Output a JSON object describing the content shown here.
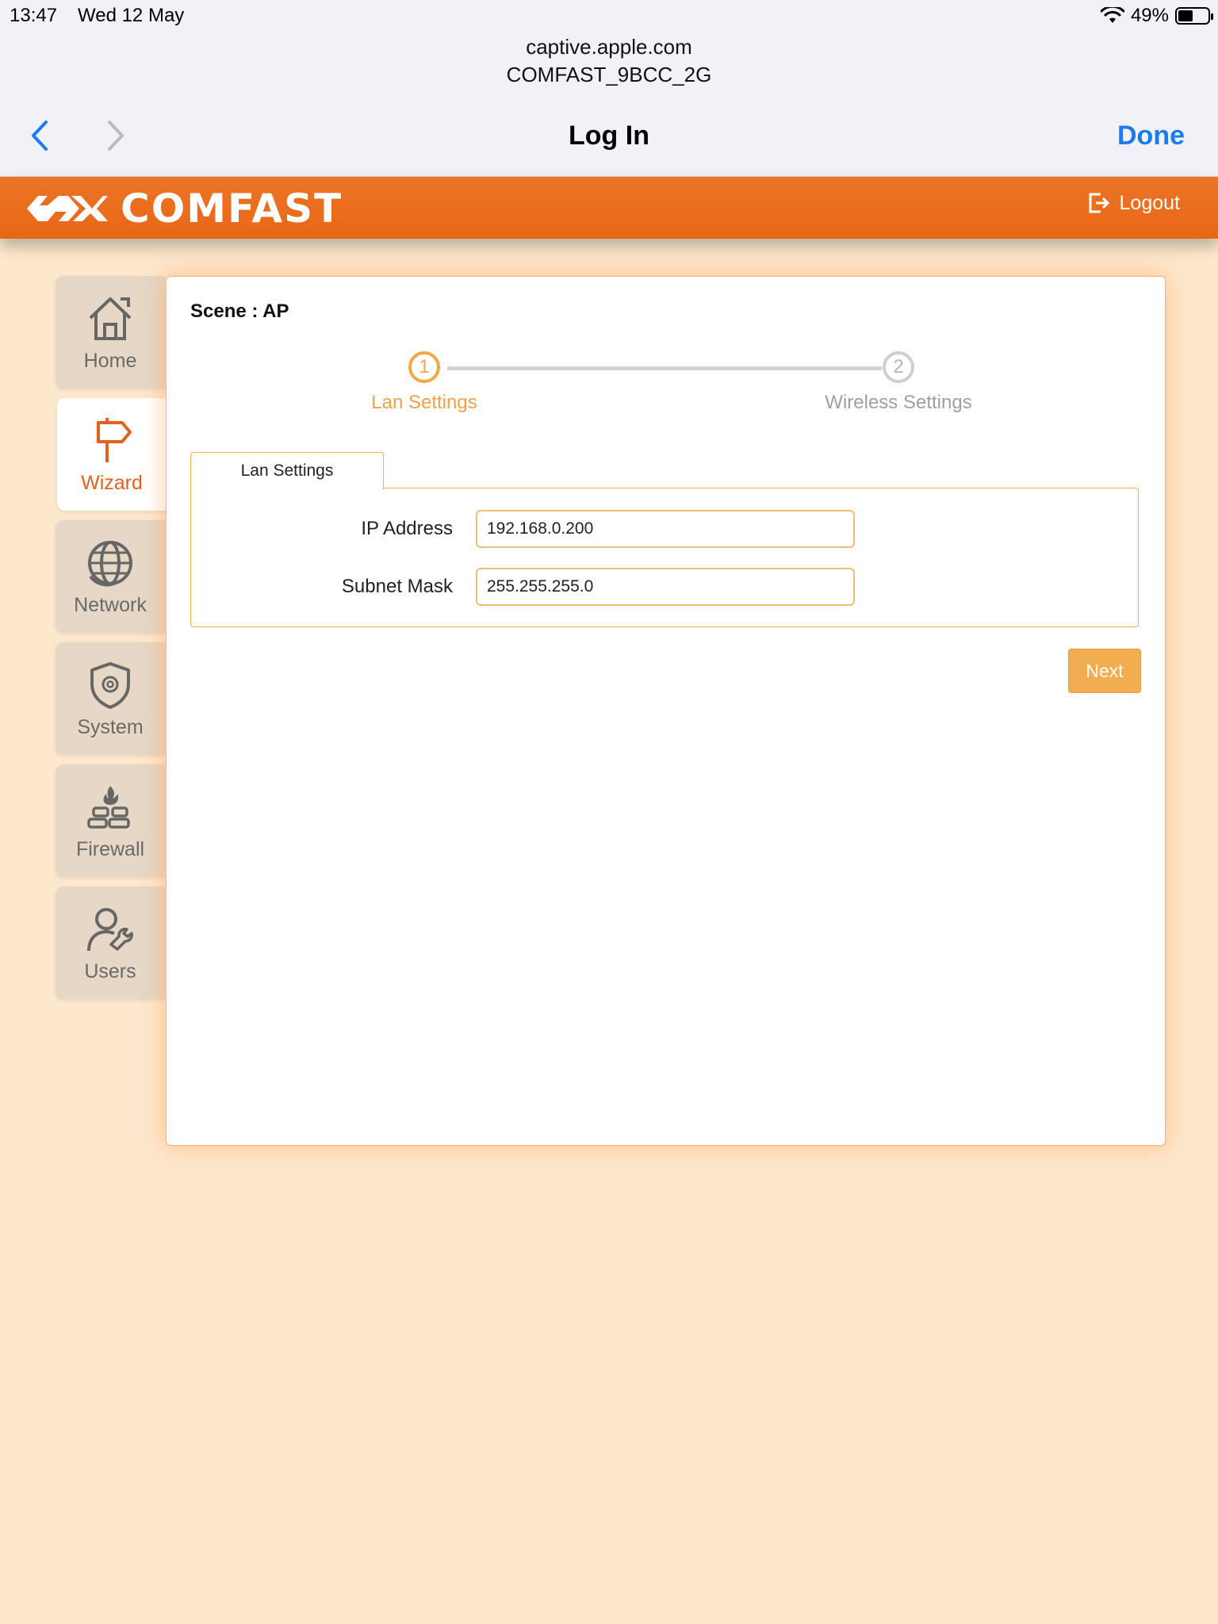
{
  "status_bar": {
    "time": "13:47",
    "date": "Wed 12 May",
    "battery": "49%",
    "battery_level": 0.49
  },
  "browser": {
    "url_host": "captive.apple.com",
    "network_name": "COMFAST_9BCC_2G",
    "title": "Log In",
    "done_label": "Done",
    "back_icon": "chevron-left-icon",
    "forward_icon": "chevron-right-icon",
    "accent_color": "#1a7cf2"
  },
  "header": {
    "brand": "COMFAST",
    "logout_label": "Logout",
    "logout_icon": "logout-icon",
    "color": "#e86717"
  },
  "sidebar": {
    "items": [
      {
        "label": "Home",
        "icon": "home-icon",
        "active": false
      },
      {
        "label": "Wizard",
        "icon": "signpost-icon",
        "active": true
      },
      {
        "label": "Network",
        "icon": "globe-icon",
        "active": false
      },
      {
        "label": "System",
        "icon": "shield-gear-icon",
        "active": false
      },
      {
        "label": "Firewall",
        "icon": "firewall-icon",
        "active": false
      },
      {
        "label": "Users",
        "icon": "user-wrench-icon",
        "active": false
      }
    ]
  },
  "main": {
    "scene": "Scene : AP",
    "steps": [
      {
        "number": "1",
        "label": "Lan Settings",
        "state": "current"
      },
      {
        "number": "2",
        "label": "Wireless Settings",
        "state": "pending"
      }
    ],
    "tab_label": "Lan Settings",
    "fields": [
      {
        "label": "IP Address",
        "value": "192.168.0.200"
      },
      {
        "label": "Subnet Mask",
        "value": "255.255.255.0"
      }
    ],
    "next_label": "Next",
    "accent_color": "#f1ad4f"
  }
}
